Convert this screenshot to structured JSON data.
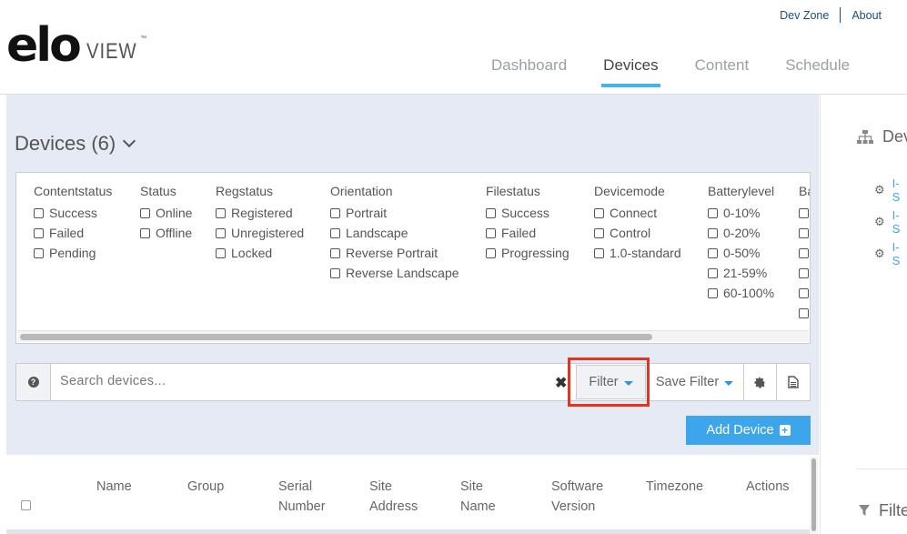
{
  "header": {
    "links": [
      "Dev Zone",
      "About"
    ],
    "logo": {
      "brand": "elo",
      "product": "VIEW",
      "tm": "™"
    },
    "nav": [
      {
        "label": "Dashboard",
        "active": false
      },
      {
        "label": "Devices",
        "active": true
      },
      {
        "label": "Content",
        "active": false
      },
      {
        "label": "Schedule",
        "active": false
      }
    ]
  },
  "devices": {
    "title": "Devices (6)"
  },
  "filters": {
    "columns": [
      {
        "header": "Contentstatus",
        "options": [
          "Success",
          "Failed",
          "Pending"
        ]
      },
      {
        "header": "Status",
        "options": [
          "Online",
          "Offline"
        ]
      },
      {
        "header": "Regstatus",
        "options": [
          "Registered",
          "Unregistered",
          "Locked"
        ]
      },
      {
        "header": "Orientation",
        "options": [
          "Portrait",
          "Landscape",
          "Reverse Portrait",
          "Reverse Landscape"
        ]
      },
      {
        "header": "Filestatus",
        "options": [
          "Success",
          "Failed",
          "Progressing"
        ]
      },
      {
        "header": "Devicemode",
        "options": [
          "Connect",
          "Control",
          "1.0-standard"
        ]
      },
      {
        "header": "Batterylevel",
        "options": [
          "0-10%",
          "0-20%",
          "0-50%",
          "21-59%",
          "60-100%"
        ]
      },
      {
        "header": "Ba",
        "options": [
          "",
          "",
          "",
          "",
          "",
          ""
        ]
      }
    ]
  },
  "toolbar": {
    "search_placeholder": "Search devices...",
    "clear": "✖",
    "filter_label": "Filter",
    "save_filter_label": "Save Filter",
    "add_device_label": "Add Device",
    "help": "?"
  },
  "table": {
    "headers": [
      {
        "line1": "",
        "line2": "Name"
      },
      {
        "line1": "",
        "line2": "Group"
      },
      {
        "line1": "Serial",
        "line2": "Number"
      },
      {
        "line1": "Site",
        "line2": "Address"
      },
      {
        "line1": "Site",
        "line2": "Name"
      },
      {
        "line1": "Software",
        "line2": "Version"
      },
      {
        "line1": "",
        "line2": "Timezone"
      },
      {
        "line1": "",
        "line2": "Actions"
      }
    ]
  },
  "right_panel": {
    "title": "Dev",
    "items": [
      "I-S",
      "I-S",
      "I-S"
    ],
    "filter_title": "Filte"
  },
  "colors": {
    "accent": "#45b4e8",
    "add_button": "#3da5ec",
    "highlight": "#e53320",
    "panel_bg": "#e6eaf4"
  }
}
